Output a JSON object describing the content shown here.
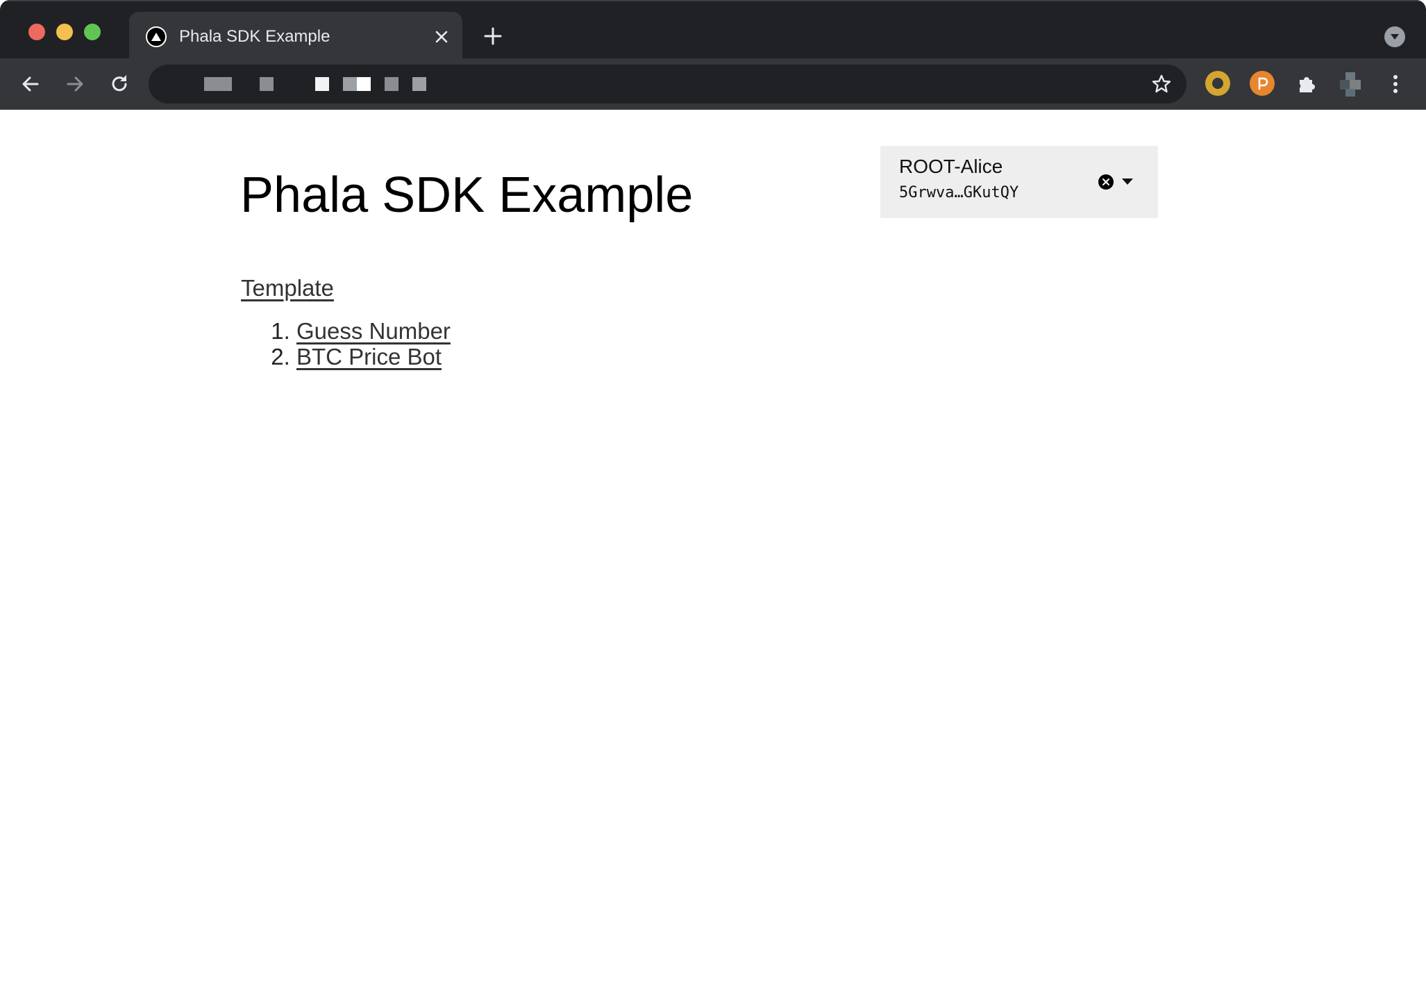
{
  "browser": {
    "tab_title": "Phala SDK Example",
    "colors": {
      "frame": "#202124",
      "toolbar": "#35363a",
      "tab_active": "#35363a"
    }
  },
  "page": {
    "title": "Phala SDK Example",
    "account": {
      "name": "ROOT-Alice",
      "address": "5Grwva…GKutQY"
    },
    "section_link": "Template",
    "examples": [
      {
        "label": "Guess Number"
      },
      {
        "label": "BTC Price Bot"
      }
    ]
  }
}
